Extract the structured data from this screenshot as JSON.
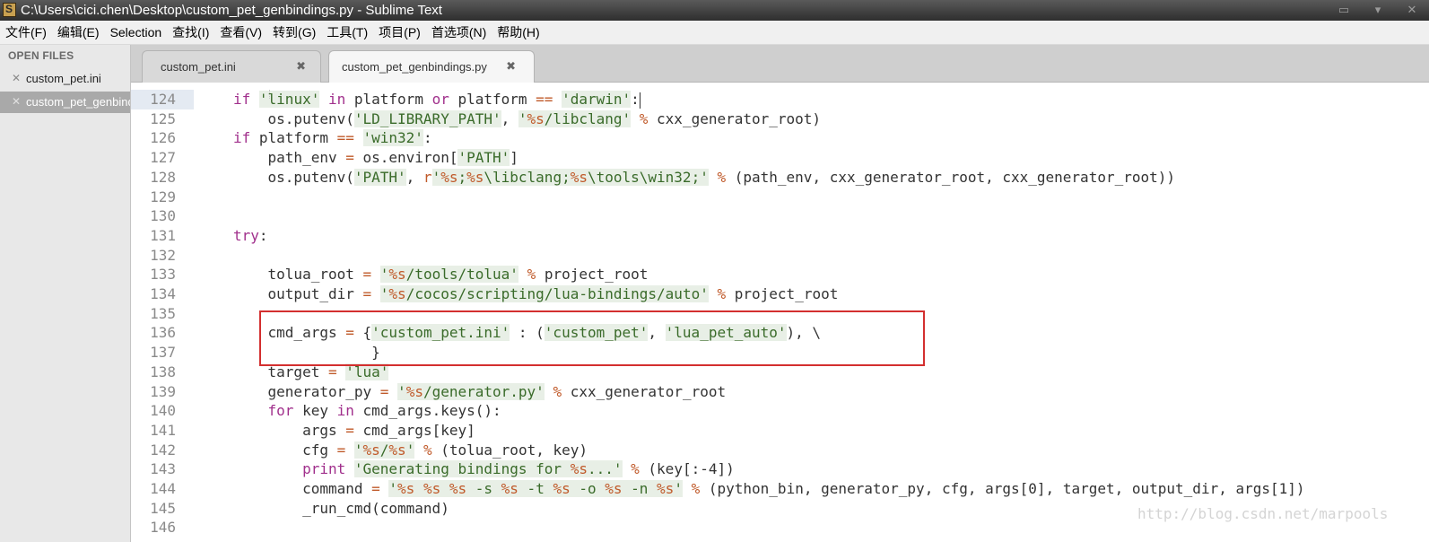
{
  "window": {
    "title": "C:\\Users\\cici.chen\\Desktop\\custom_pet_genbindings.py - Sublime Text"
  },
  "menu": [
    "文件(F)",
    "编辑(E)",
    "Selection",
    "查找(I)",
    "查看(V)",
    "转到(G)",
    "工具(T)",
    "项目(P)",
    "首选项(N)",
    "帮助(H)"
  ],
  "sidebar": {
    "heading": "OPEN FILES",
    "files": [
      {
        "name": "custom_pet.ini",
        "close": "✕"
      },
      {
        "name": "custom_pet_genbindings.py",
        "close": "✕",
        "selected": true
      }
    ]
  },
  "tabs": [
    {
      "label": "custom_pet.ini",
      "close": "✖"
    },
    {
      "label": "custom_pet_genbindings.py",
      "close": "✖",
      "active": true
    }
  ],
  "editor": {
    "current_line": 124,
    "lines": [
      {
        "n": "124",
        "text": "    if 'linux' in platform or platform == 'darwin':"
      },
      {
        "n": "125",
        "text": "        os.putenv('LD_LIBRARY_PATH', '%s/libclang' % cxx_generator_root)"
      },
      {
        "n": "126",
        "text": "    if platform == 'win32':"
      },
      {
        "n": "127",
        "text": "        path_env = os.environ['PATH']"
      },
      {
        "n": "128",
        "text": "        os.putenv('PATH', r'%s;%s\\libclang;%s\\tools\\win32;' % (path_env, cxx_generator_root, cxx_generator_root))"
      },
      {
        "n": "129",
        "text": ""
      },
      {
        "n": "130",
        "text": ""
      },
      {
        "n": "131",
        "text": "    try:"
      },
      {
        "n": "132",
        "text": ""
      },
      {
        "n": "133",
        "text": "        tolua_root = '%s/tools/tolua' % project_root"
      },
      {
        "n": "134",
        "text": "        output_dir = '%s/cocos/scripting/lua-bindings/auto' % project_root"
      },
      {
        "n": "135",
        "text": ""
      },
      {
        "n": "136",
        "text": "        cmd_args = {'custom_pet.ini' : ('custom_pet', 'lua_pet_auto'), \\"
      },
      {
        "n": "137",
        "text": "                    }"
      },
      {
        "n": "138",
        "text": "        target = 'lua'"
      },
      {
        "n": "139",
        "text": "        generator_py = '%s/generator.py' % cxx_generator_root"
      },
      {
        "n": "140",
        "text": "        for key in cmd_args.keys():"
      },
      {
        "n": "141",
        "text": "            args = cmd_args[key]"
      },
      {
        "n": "142",
        "text": "            cfg = '%s/%s' % (tolua_root, key)"
      },
      {
        "n": "143",
        "text": "            print 'Generating bindings for %s...' % (key[:-4])"
      },
      {
        "n": "144",
        "text": "            command = '%s %s %s -s %s -t %s -o %s -n %s' % (python_bin, generator_py, cfg, args[0], target, output_dir, args[1])"
      },
      {
        "n": "145",
        "text": "            _run_cmd(command)"
      },
      {
        "n": "146",
        "text": ""
      }
    ]
  },
  "watermark": "http://blog.csdn.net/marpools",
  "colors": {
    "keyword": "#a1308c",
    "string": "#3a6b2a",
    "operator": "#c05a2a",
    "highlight_box": "#d32f2f"
  }
}
